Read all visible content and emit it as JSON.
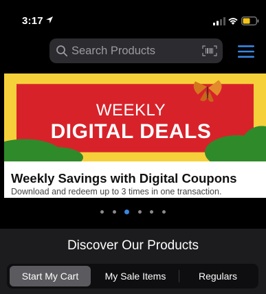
{
  "status_bar": {
    "time": "3:17"
  },
  "search": {
    "placeholder": "Search Products"
  },
  "banner": {
    "line1": "WEEKLY",
    "line2": "DIGITAL DEALS",
    "title": "Weekly Savings with Digital Coupons",
    "subtitle": "Download and redeem up to 3 times in one transaction."
  },
  "carousel": {
    "count": 6,
    "active": 2
  },
  "discover": {
    "title": "Discover Our Products",
    "tabs": [
      {
        "label": "Start My Cart"
      },
      {
        "label": "My Sale Items"
      },
      {
        "label": "Regulars"
      }
    ]
  },
  "colors": {
    "accent": "#3a86e0",
    "banner_red": "#d8222a",
    "banner_yellow": "#f6d03a",
    "leaf_green": "#2f8a2a"
  }
}
